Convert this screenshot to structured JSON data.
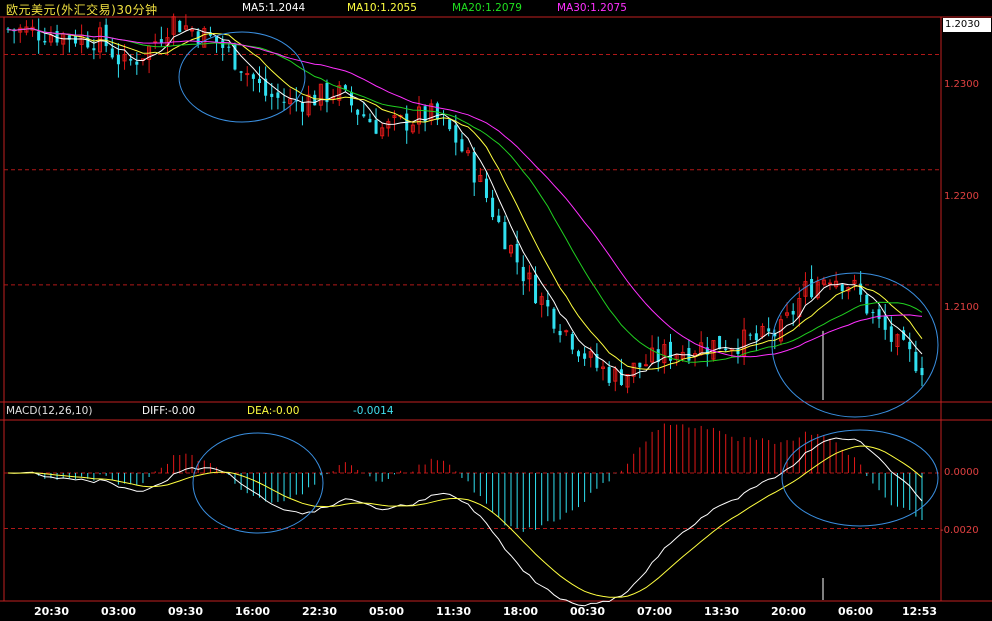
{
  "header": {
    "title": "欧元美元(外汇交易)30分钟",
    "ma5": "MA5:1.2044",
    "ma10": "MA10:1.2055",
    "ma20": "MA20:1.2079",
    "ma30": "MA30:1.2075"
  },
  "macd_header": {
    "name": "MACD(12,26,10)",
    "diff": "DIFF:-0.00",
    "dea": "DEA:-0.00",
    "hist": "-0.0014"
  },
  "last_price": "1.2030",
  "colors": {
    "up": "#e01818",
    "down": "#30e0f0",
    "ma5": "#ffffff",
    "ma10": "#ffff40",
    "ma20": "#20d020",
    "ma30": "#ff30ff",
    "grid": "#b01818",
    "circle": "#3a8fe0"
  },
  "chart_data": [
    {
      "type": "candlestick",
      "title": "欧元美元(外汇交易)30分钟",
      "series": [
        {
          "name": "MA5",
          "value": 1.2044
        },
        {
          "name": "MA10",
          "value": 1.2055
        },
        {
          "name": "MA20",
          "value": 1.2079
        },
        {
          "name": "MA30",
          "value": 1.2075
        }
      ],
      "y_ticks": [
        "1.2300",
        "1.2200",
        "1.2100"
      ],
      "ylim": [
        1.2,
        1.233
      ],
      "last_value": 1.203,
      "approx_close_path": [
        1.2322,
        1.232,
        1.2318,
        1.2315,
        1.2313,
        1.229,
        1.2305,
        1.233,
        1.232,
        1.231,
        1.229,
        1.2265,
        1.2258,
        1.2262,
        1.2268,
        1.225,
        1.2235,
        1.2242,
        1.2248,
        1.223,
        1.2195,
        1.215,
        1.211,
        1.208,
        1.2055,
        1.203,
        1.202,
        1.203,
        1.204,
        1.2045,
        1.2048,
        1.205,
        1.2052,
        1.206,
        1.2095,
        1.211,
        1.21,
        1.207,
        1.2045,
        1.203
      ]
    },
    {
      "type": "bar",
      "title": "MACD(12,26,10)",
      "series": [
        {
          "name": "DIFF",
          "value": -0.0
        },
        {
          "name": "DEA",
          "value": -0.0
        },
        {
          "name": "MACD",
          "value": -0.0014
        }
      ],
      "y_ticks": [
        "0.0000",
        "-0.0020"
      ],
      "ylim": [
        -0.0045,
        0.0018
      ]
    }
  ],
  "x_labels": [
    "20:30",
    "03:00",
    "09:30",
    "16:00",
    "22:30",
    "05:00",
    "11:30",
    "18:00",
    "00:30",
    "07:00",
    "13:30",
    "20:00",
    "06:00",
    "12:53"
  ]
}
